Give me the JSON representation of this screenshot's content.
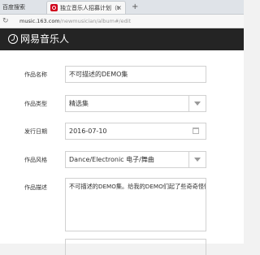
{
  "browser": {
    "tabs": [
      {
        "label": "百度搜索",
        "active": false
      },
      {
        "label": "独立音乐人招募计划（t",
        "active": true
      }
    ],
    "new_tab_label": "+",
    "tab_close_label": "×",
    "url_host": "music.163.com",
    "url_path": "/newmusician/album#/edit",
    "reload_label": "↻"
  },
  "header": {
    "logo_text": "网易音乐人"
  },
  "form": {
    "name_label": "作品名称",
    "name_value": "不可描述的DEMO集",
    "type_label": "作品类型",
    "type_value": "精选集",
    "date_label": "发行日期",
    "date_value": "2016-07-10",
    "style_label": "作品风格",
    "style_value": "Dance/Electronic 电子/舞曲",
    "desc_label": "作品描述",
    "desc_value": "不可描述的DEMO集。给我的DEMO们起了些奇奇怪怪的名字。"
  },
  "colors": {
    "header_bg": "#242424",
    "brand_red": "#d0021b"
  }
}
